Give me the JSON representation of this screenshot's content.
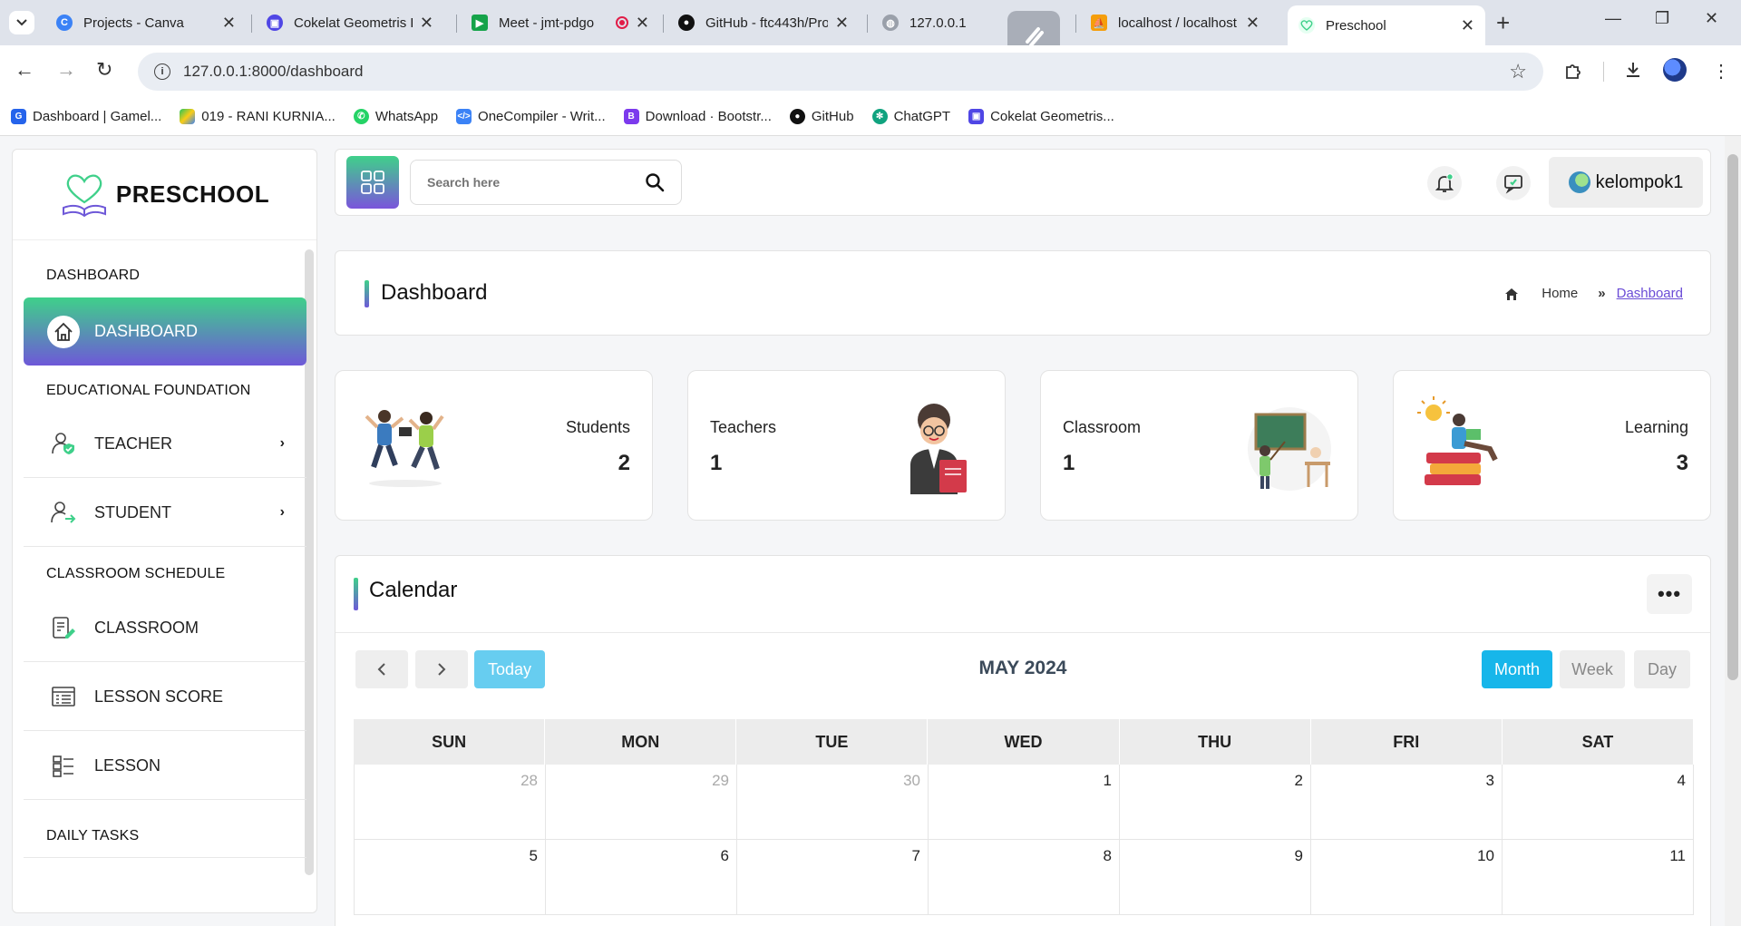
{
  "browser": {
    "tabs": [
      {
        "title": "Projects - Canva",
        "icon": "canva-icon",
        "color": "#3b82f6"
      },
      {
        "title": "Cokelat Geometris Kr",
        "icon": "presentation-icon",
        "color": "#4f46e5"
      },
      {
        "title": "Meet - jmt-pdgo",
        "icon": "meet-icon",
        "color": "#16a34a"
      },
      {
        "title": "GitHub - ftc443h/Pro",
        "icon": "github-icon",
        "color": "#111111"
      },
      {
        "title": "127.0.0.1",
        "icon": "globe-icon",
        "color": "#888888"
      },
      {
        "title": "localhost / localhost",
        "icon": "phpmyadmin-icon",
        "color": "#f59e0b"
      },
      {
        "title": "Preschool",
        "icon": "preschool-icon",
        "color": "#3fd08a"
      }
    ],
    "url": "127.0.0.1:8000/dashboard",
    "bookmarks": [
      {
        "label": "Dashboard | Gamel...",
        "color": "#2563eb"
      },
      {
        "label": "019 - RANI KURNIA...",
        "color": "#22c55e"
      },
      {
        "label": "WhatsApp",
        "color": "#25d366"
      },
      {
        "label": "OneCompiler - Writ...",
        "color": "#3b82f6"
      },
      {
        "label": "Download · Bootstr...",
        "color": "#7c3aed"
      },
      {
        "label": "GitHub",
        "color": "#111111"
      },
      {
        "label": "ChatGPT",
        "color": "#10a37f"
      },
      {
        "label": "Cokelat Geometris...",
        "color": "#4f46e5"
      }
    ]
  },
  "sidebar": {
    "brand": "PRESCHOOL",
    "sections": {
      "dashboard": "DASHBOARD",
      "foundation": "EDUCATIONAL FOUNDATION",
      "schedule": "CLASSROOM SCHEDULE",
      "daily": "DAILY TASKS"
    },
    "items": {
      "dashboard": "DASHBOARD",
      "teacher": "TEACHER",
      "student": "STUDENT",
      "classroom": "CLASSROOM",
      "lesson_score": "LESSON SCORE",
      "lesson": "LESSON"
    }
  },
  "topbar": {
    "search_placeholder": "Search here",
    "username": "kelompok1"
  },
  "page": {
    "title": "Dashboard",
    "breadcrumb_home": "Home",
    "breadcrumb_current": "Dashboard"
  },
  "stats": [
    {
      "label": "Students",
      "value": "2"
    },
    {
      "label": "Teachers",
      "value": "1"
    },
    {
      "label": "Classroom",
      "value": "1"
    },
    {
      "label": "Learning",
      "value": "3"
    }
  ],
  "calendar": {
    "title": "Calendar",
    "month_label": "MAY 2024",
    "today_label": "Today",
    "views": {
      "month": "Month",
      "week": "Week",
      "day": "Day"
    },
    "weekdays": [
      "SUN",
      "MON",
      "TUE",
      "WED",
      "THU",
      "FRI",
      "SAT"
    ],
    "weeks": [
      [
        "28",
        "29",
        "30",
        "1",
        "2",
        "3",
        "4"
      ],
      [
        "5",
        "6",
        "7",
        "8",
        "9",
        "10",
        "11"
      ]
    ]
  },
  "colors": {
    "accent_green": "#3fd08a",
    "accent_purple": "#6e58d8",
    "month_button": "#17b6ea",
    "today_button": "#67cdf0"
  }
}
